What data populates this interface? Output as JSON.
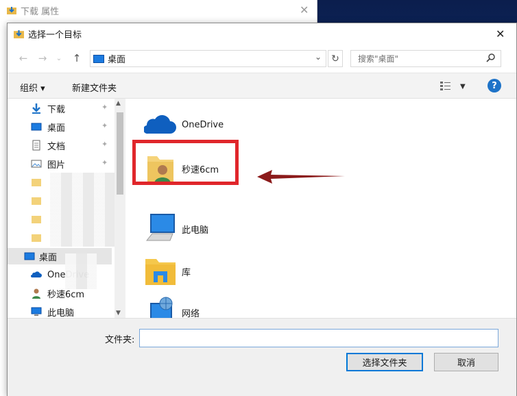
{
  "bg_window": {
    "title": "下载 属性",
    "close": "✕"
  },
  "dialog": {
    "title": "选择一个目标",
    "close": "✕",
    "address": "桌面",
    "search_placeholder": "搜索\"桌面\"",
    "toolbar": {
      "organize": "组织 ▾",
      "new_folder": "新建文件夹"
    },
    "help": "?",
    "tree": [
      {
        "label": "下载",
        "icon": "download-icon",
        "pinned": true
      },
      {
        "label": "桌面",
        "icon": "desktop-icon",
        "pinned": true
      },
      {
        "label": "文档",
        "icon": "document-icon",
        "pinned": true
      },
      {
        "label": "图片",
        "icon": "picture-icon",
        "pinned": true
      },
      {
        "label": "桌面",
        "icon": "desktop-icon",
        "selected": true
      },
      {
        "label": "OneDrive",
        "icon": "onedrive-icon"
      },
      {
        "label": "秒速6cm",
        "icon": "user-icon"
      },
      {
        "label": "此电脑",
        "icon": "computer-icon"
      }
    ],
    "items": [
      {
        "label": "OneDrive",
        "icon": "onedrive-icon"
      },
      {
        "label": "秒速6cm",
        "icon": "user-folder-icon"
      },
      {
        "label": "此电脑",
        "icon": "computer-icon"
      },
      {
        "label": "库",
        "icon": "library-icon"
      },
      {
        "label": "网络",
        "icon": "network-icon"
      }
    ],
    "footer": {
      "folder_label": "文件夹:",
      "folder_value": "",
      "select_button": "选择文件夹",
      "cancel_button": "取消"
    }
  }
}
